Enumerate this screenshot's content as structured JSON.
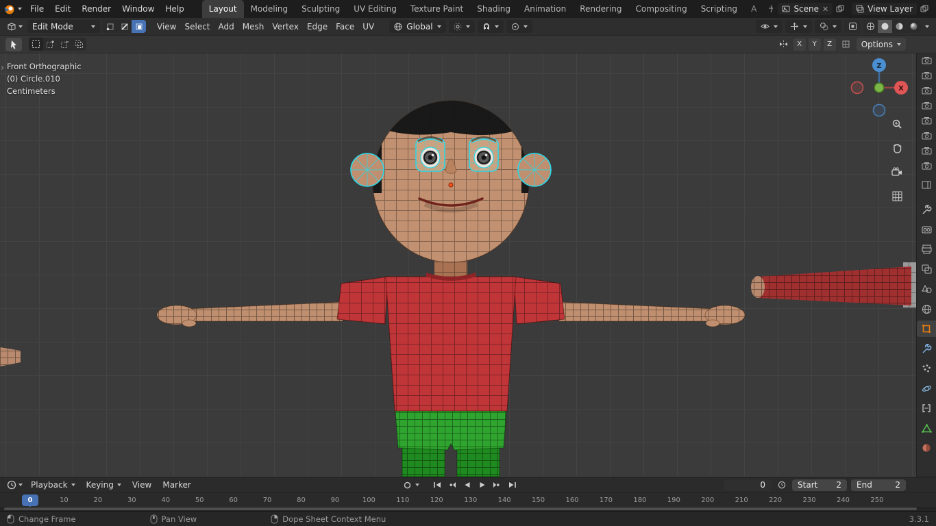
{
  "topbar": {
    "menus": [
      "File",
      "Edit",
      "Render",
      "Window",
      "Help"
    ],
    "workspaces": [
      "Layout",
      "Modeling",
      "Sculpting",
      "UV Editing",
      "Texture Paint",
      "Shading",
      "Animation",
      "Rendering",
      "Compositing",
      "Scripting"
    ],
    "workspace_overflow": "A",
    "scene_field": {
      "value": "Scene"
    },
    "view_layer_field": {
      "value": "View Layer"
    }
  },
  "header": {
    "mode_select": "Edit Mode",
    "select_mode_icons": [
      "vertex-select-icon",
      "edge-select-icon",
      "face-select-icon"
    ],
    "menus": [
      "View",
      "Select",
      "Add",
      "Mesh",
      "Vertex",
      "Edge",
      "Face",
      "UV"
    ],
    "orientation_select": "Global",
    "right_icons": [
      "visibility-eye-icon",
      "gizmos-icon",
      "overlays-icon",
      "xray-icon",
      "shading-wireframe-icon",
      "shading-solid-icon",
      "shading-material-icon",
      "shading-rendered-icon"
    ]
  },
  "tool_settings": {
    "tool_icons": [
      "tweak-tool-icon",
      "select-box-icon",
      "select-box-extend-icon",
      "select-box-subtract-icon",
      "select-box-intersect-icon"
    ],
    "axis_toggles": [
      "X",
      "Y",
      "Z"
    ],
    "options_label": "Options"
  },
  "viewport": {
    "overlay_text": [
      "Front Orthographic",
      "(0) Circle.010",
      "Centimeters"
    ],
    "gizmo": {
      "z_label": "Z",
      "x_label": "X"
    },
    "nav_icons": [
      "zoom-icon",
      "pan-hand-icon",
      "camera-view-icon",
      "grid-ortho-icon"
    ],
    "right_rail": {
      "editor_icon": "outliner-editor-icon",
      "outliner_icons": [
        "render-output-icon",
        "render-output-icon",
        "render-output-icon",
        "render-output-icon",
        "render-output-icon",
        "render-output-icon",
        "render-output-icon",
        "render-output-icon"
      ],
      "properties_tabs": [
        "tool-icon",
        "render-icon",
        "output-icon",
        "view-layer-icon",
        "scene-icon",
        "world-icon",
        "object-icon",
        "modifiers-icon",
        "particles-icon",
        "physics-icon",
        "constraints-icon",
        "object-data-icon",
        "material-icon"
      ]
    }
  },
  "timeline": {
    "menus": [
      "Playback",
      "Keying",
      "View",
      "Marker"
    ],
    "current_frame": "0",
    "playhead_frame": "0",
    "start": {
      "label": "Start",
      "value": "2"
    },
    "end": {
      "label": "End",
      "value": "2"
    },
    "ticks": [
      "0",
      "10",
      "20",
      "30",
      "40",
      "50",
      "60",
      "70",
      "80",
      "90",
      "100",
      "110",
      "120",
      "130",
      "140",
      "150",
      "160",
      "170",
      "180",
      "190",
      "200",
      "210",
      "220",
      "230",
      "240",
      "250"
    ]
  },
  "statusbar": {
    "hints": [
      {
        "icon": "mouse-left-icon",
        "label": "Change Frame"
      },
      {
        "icon": "mouse-middle-icon",
        "label": "Pan View"
      },
      {
        "icon": "mouse-right-icon",
        "label": "Dope Sheet Context Menu"
      }
    ],
    "version": "3.3.1"
  },
  "colors": {
    "accent": "#4772b3",
    "selection_cyan": "#2bd7e8",
    "object_orange": "#e87d0d",
    "shirt_red": "#bf3538",
    "shorts_green": "#2fa42f",
    "skin": "#c29171",
    "hair": "#191919"
  }
}
